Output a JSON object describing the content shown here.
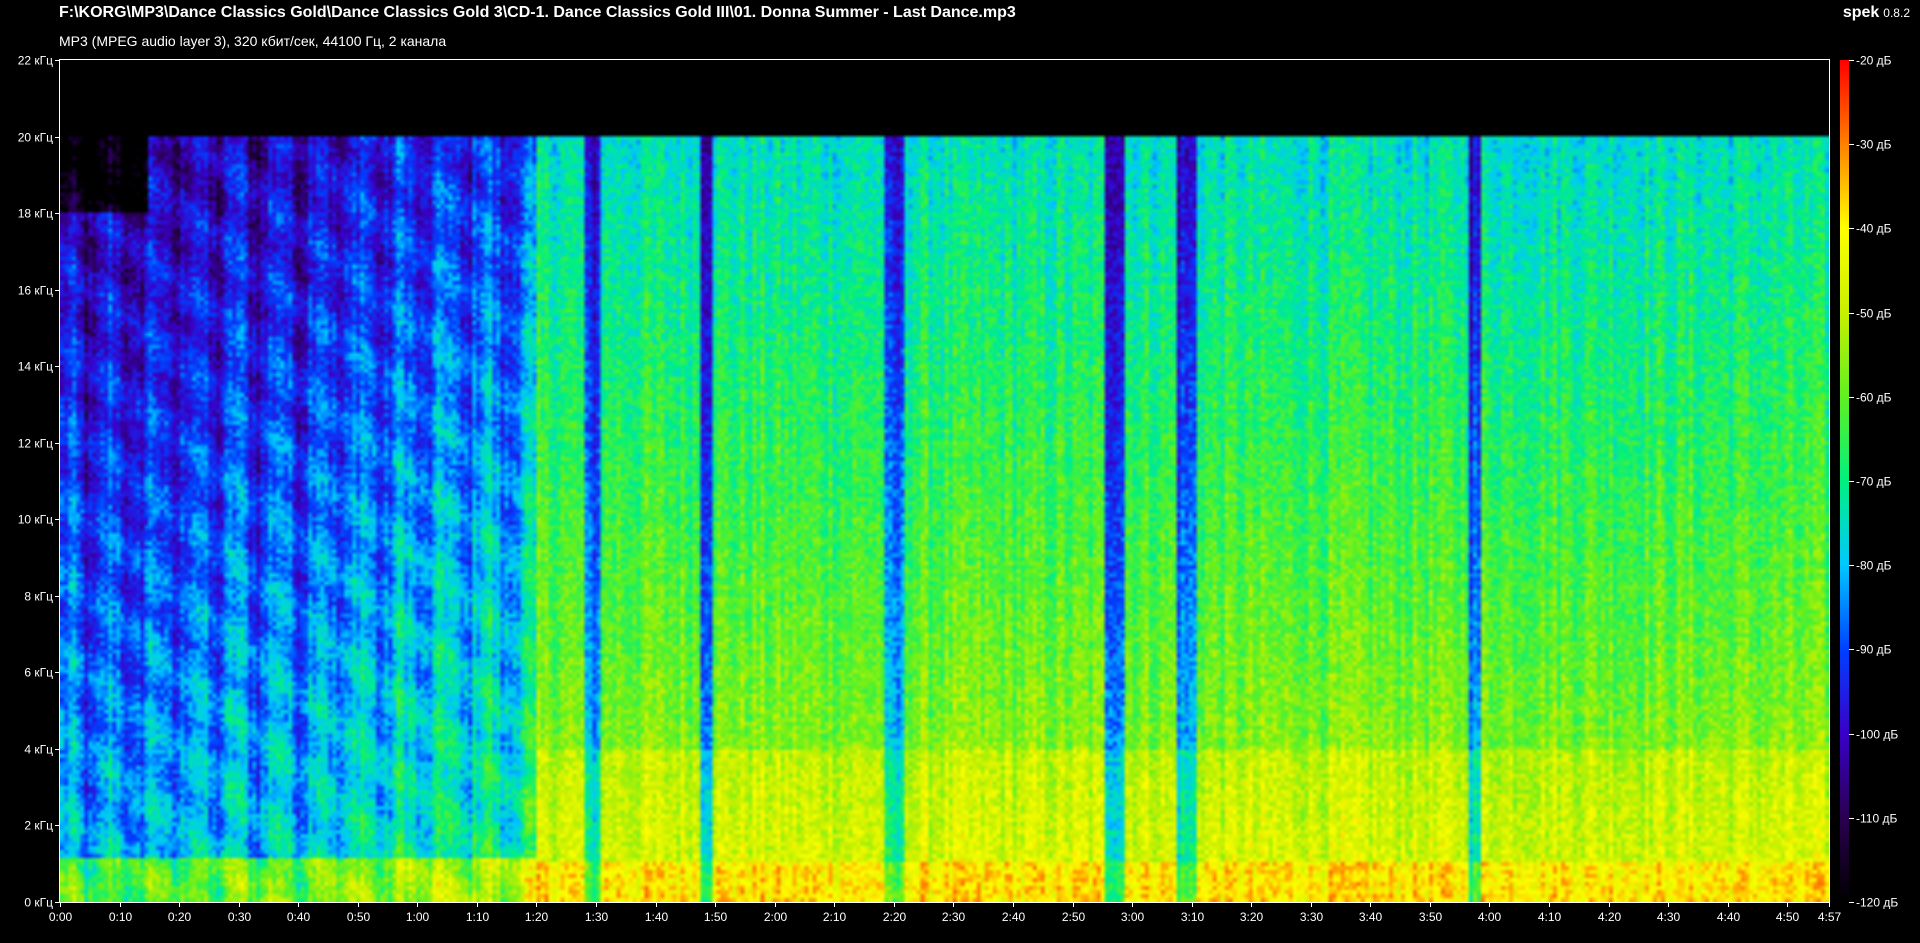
{
  "header": {
    "file_path": "F:\\KORG\\MP3\\Dance Classics Gold\\Dance Classics Gold 3\\CD-1. Dance Classics Gold III\\01. Donna Summer - Last Dance.mp3",
    "format_info": "MP3 (MPEG audio layer 3), 320 кбит/сек, 44100 Гц, 2 канала",
    "app_name": "spek",
    "app_version": "0.8.2"
  },
  "chart_data": {
    "type": "heatmap",
    "x_axis": {
      "unit": "time (s)",
      "range": [
        0,
        297
      ],
      "tick_values": [
        0,
        10,
        20,
        30,
        40,
        50,
        60,
        70,
        80,
        90,
        100,
        110,
        120,
        130,
        140,
        150,
        160,
        170,
        180,
        190,
        200,
        210,
        220,
        230,
        240,
        250,
        260,
        270,
        280,
        290,
        297
      ],
      "tick_labels": [
        "0:00",
        "0:10",
        "0:20",
        "0:30",
        "0:40",
        "0:50",
        "1:00",
        "1:10",
        "1:20",
        "1:30",
        "1:40",
        "1:50",
        "2:00",
        "2:10",
        "2:20",
        "2:30",
        "2:40",
        "2:50",
        "3:00",
        "3:10",
        "3:20",
        "3:30",
        "3:40",
        "3:50",
        "4:00",
        "4:10",
        "4:20",
        "4:30",
        "4:40",
        "4:50",
        "4:57"
      ]
    },
    "y_axis": {
      "unit": "frequency (kHz)",
      "range": [
        0,
        22
      ],
      "tick_values": [
        0,
        2,
        4,
        6,
        8,
        10,
        12,
        14,
        16,
        18,
        20,
        22
      ],
      "tick_labels": [
        "0 кГц",
        "2 кГц",
        "4 кГц",
        "6 кГц",
        "8 кГц",
        "10 кГц",
        "12 кГц",
        "14 кГц",
        "16 кГц",
        "18 кГц",
        "20 кГц",
        "22 кГц"
      ]
    },
    "color_scale": {
      "unit": "dB",
      "range": [
        -120,
        -20
      ],
      "tick_values": [
        -20,
        -30,
        -40,
        -50,
        -60,
        -70,
        -80,
        -90,
        -100,
        -110,
        -120
      ],
      "tick_labels": [
        "-20 дБ",
        "-30 дБ",
        "-40 дБ",
        "-50 дБ",
        "-60 дБ",
        "-70 дБ",
        "-80 дБ",
        "-90 дБ",
        "-100 дБ",
        "-110 дБ",
        "-120 дБ"
      ],
      "stops": [
        {
          "db": -120,
          "color": "#000000"
        },
        {
          "db": -110,
          "color": "#2a0050"
        },
        {
          "db": -100,
          "color": "#3a00c8"
        },
        {
          "db": -90,
          "color": "#0040ff"
        },
        {
          "db": -80,
          "color": "#00c8ff"
        },
        {
          "db": -70,
          "color": "#00f080"
        },
        {
          "db": -60,
          "color": "#60f020"
        },
        {
          "db": -50,
          "color": "#c8f000"
        },
        {
          "db": -40,
          "color": "#ffff00"
        },
        {
          "db": -30,
          "color": "#ff8000"
        },
        {
          "db": -20,
          "color": "#ff0000"
        }
      ]
    },
    "spectrogram_cutoff_khz": 20,
    "intro_end_s": 80,
    "quiet_gaps_s": [
      [
        88.5,
        90
      ],
      [
        108.5,
        109
      ],
      [
        139.5,
        141
      ],
      [
        176.5,
        178
      ],
      [
        188,
        190
      ],
      [
        237,
        238
      ]
    ],
    "background_color": "#000000",
    "text_color": "#ffffff"
  }
}
